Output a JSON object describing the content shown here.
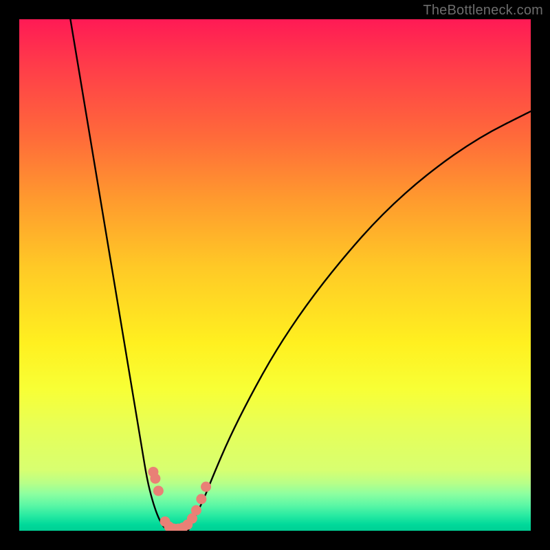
{
  "watermark": "TheBottleneck.com",
  "chart_data": {
    "type": "line",
    "title": "",
    "xlabel": "",
    "ylabel": "",
    "xlim": [
      0,
      100
    ],
    "ylim": [
      0,
      100
    ],
    "grid": false,
    "legend": false,
    "series": [
      {
        "name": "left-curve",
        "x": [
          10,
          12,
          14,
          16,
          18,
          20,
          22,
          24,
          25,
          26,
          27,
          28,
          29
        ],
        "y": [
          100,
          88,
          76,
          64,
          52,
          40,
          28,
          16,
          10,
          6,
          3,
          1,
          0
        ]
      },
      {
        "name": "right-curve",
        "x": [
          33,
          34,
          36,
          38,
          41,
          45,
          50,
          56,
          63,
          71,
          80,
          90,
          100
        ],
        "y": [
          0,
          2,
          6,
          11,
          18,
          26,
          35,
          44,
          53,
          62,
          70,
          77,
          82
        ]
      },
      {
        "name": "bottom-join",
        "x": [
          29,
          30,
          31,
          32,
          33
        ],
        "y": [
          0,
          0,
          0,
          0,
          0
        ]
      }
    ],
    "markers": [
      {
        "x": 26.2,
        "y": 11.5
      },
      {
        "x": 26.6,
        "y": 10.2
      },
      {
        "x": 27.2,
        "y": 7.8
      },
      {
        "x": 28.5,
        "y": 1.8
      },
      {
        "x": 29.3,
        "y": 0.8
      },
      {
        "x": 30.2,
        "y": 0.4
      },
      {
        "x": 31.1,
        "y": 0.4
      },
      {
        "x": 32.0,
        "y": 0.6
      },
      {
        "x": 32.9,
        "y": 1.2
      },
      {
        "x": 33.8,
        "y": 2.4
      },
      {
        "x": 34.6,
        "y": 4.0
      },
      {
        "x": 35.6,
        "y": 6.2
      },
      {
        "x": 36.5,
        "y": 8.6
      }
    ],
    "marker_color": "#e98076",
    "curve_color": "#000000",
    "gradient_stops": [
      {
        "pos": 0,
        "color": "#ff1a55"
      },
      {
        "pos": 50,
        "color": "#fff020"
      },
      {
        "pos": 92,
        "color": "#7cffa0"
      },
      {
        "pos": 100,
        "color": "#00cf94"
      }
    ]
  }
}
